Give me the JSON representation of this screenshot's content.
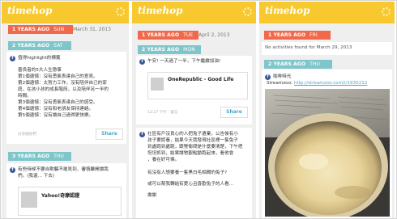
{
  "brand": "timehop",
  "columns": [
    {
      "section1": {
        "years": "1 YEARS AGO",
        "day": "SUN",
        "date": "March 31, 2013"
      },
      "section2": {
        "years": "2 YEARS AGO",
        "day": "SAT"
      },
      "post1": {
        "title": "值得highlight的標籤",
        "lines": [
          "善良者的5大人生懲事",
          "第1個遺憾：沒有勇氣表達自己的意見。",
          "第2個遺憾：太努力工作，沒有陪伴自己的家",
          "庭，在孩小孩的成長階段，以及陪伴另一半的",
          "時間。",
          "第3個遺憾：沒有勇氣表達自己的感受。",
          "第4個遺憾：沒有和老朋友保持連絡。",
          "第5個遺憾：沒有讓自己過得更快樂。"
        ],
        "footer": "分享給你們",
        "share": "Share"
      },
      "section3": {
        "years": "3 YEARS AGO",
        "day": "THU"
      },
      "post2": {
        "line1": "有些時候不要自欺騙不敢見到、審慎離開讓我",
        "line2": "們。(我還... 下去)",
        "link_title": "Yahoo!奇摩認證"
      }
    },
    {
      "section1": {
        "years": "1 YEARS AGO",
        "day": "TUE",
        "date": "April 2, 2013"
      },
      "section2": {
        "years": "2 YEARS AGO",
        "day": "MON"
      },
      "post1": {
        "line": "午安! 一天過了一半，下午繼續加油!",
        "link_title": "OneRepublic - Good Life",
        "footer": "12:27 下午 · 留言",
        "share": "Share"
      },
      "post2": {
        "lines": [
          "社區有戶沒良心的人把兔子遺棄，公告後有小",
          "孩子要認養，結果今天我發現社區裡一隻兔子",
          "到處跑到處跑，跟警衛問是什麼要清楚，下午把",
          "坦坦抓到，結果讓牠觀點動跑起來，看他會",
          "，養在好可憐。"
        ],
        "q1": "有沒有人想要養一隻黑白毛相間的兔子?",
        "q2": "或可以幫我轉給有愛心且喜歡兔子的人看...",
        "thanks": "謝謝"
      }
    },
    {
      "section1": {
        "years": "1 YEARS AGO",
        "day": "FRI",
        "notice": "No activities found for March 29, 2013"
      },
      "section2": {
        "years": "2 YEARS AGO",
        "day": "THU"
      },
      "post1": {
        "title": "咖啡時光",
        "source": "Streamzoo:",
        "url": "http://streamzoo.com/i/1930212"
      }
    }
  ],
  "colors": {
    "header": "#f7c92e",
    "orange_pill": "#f0694b",
    "teal_pill": "#7fc6cb",
    "facebook": "#3b5998",
    "link": "#4aa8c9"
  }
}
